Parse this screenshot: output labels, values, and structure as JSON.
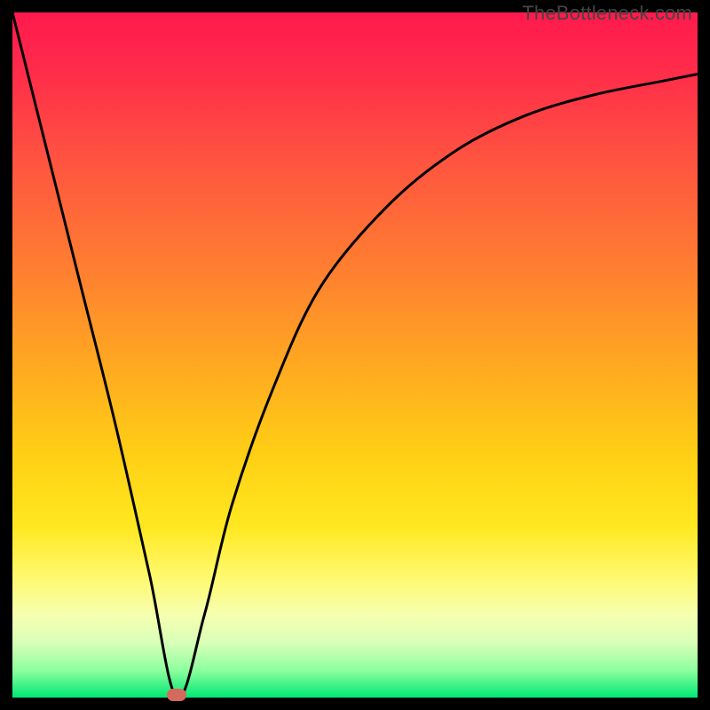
{
  "watermark": "TheBottleneck.com",
  "colors": {
    "frame": "#000000",
    "curve": "#000000",
    "marker": "#d46a5e",
    "gradient_top": "#ff1a4d",
    "gradient_bottom": "#00e874"
  },
  "chart_data": {
    "type": "line",
    "title": "",
    "xlabel": "",
    "ylabel": "",
    "xlim": [
      0,
      100
    ],
    "ylim": [
      0,
      100
    ],
    "grid": false,
    "legend": false,
    "annotations": [
      {
        "label": "minimum-marker",
        "x": 24,
        "y": 0
      }
    ],
    "series": [
      {
        "name": "bottleneck-curve",
        "x": [
          0,
          5,
          10,
          15,
          20,
          24,
          28,
          32,
          38,
          45,
          55,
          65,
          75,
          85,
          95,
          100
        ],
        "y": [
          100,
          80,
          60,
          40,
          18,
          0,
          12,
          28,
          45,
          60,
          72,
          80,
          85,
          88,
          90,
          91
        ]
      }
    ]
  }
}
